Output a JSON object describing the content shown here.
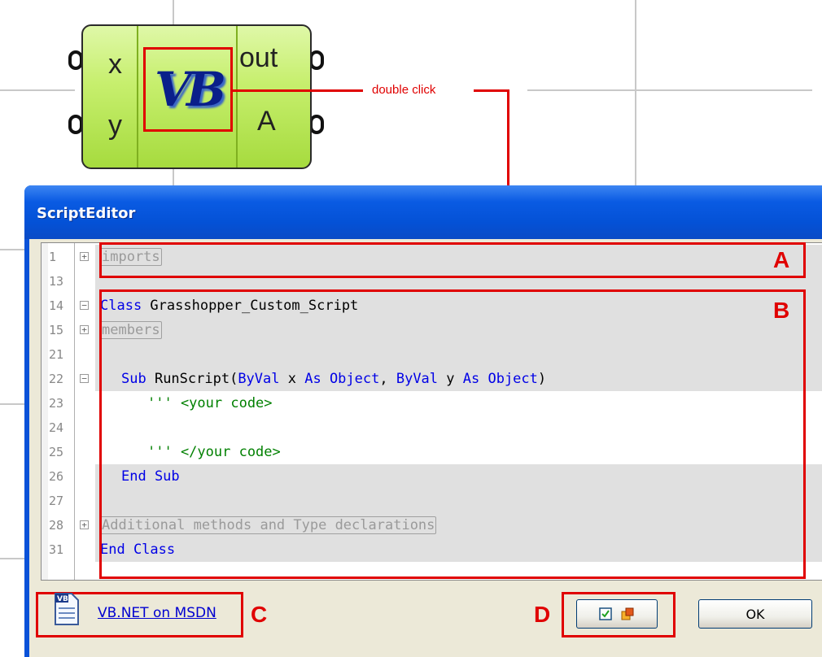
{
  "component": {
    "inputs": [
      "x",
      "y"
    ],
    "outputs": [
      "out",
      "A"
    ],
    "icon_text": "VB",
    "annotation": "double click"
  },
  "window": {
    "title": "ScriptEditor"
  },
  "editor": {
    "lines": [
      {
        "num": "1",
        "fold": "+",
        "text": "imports",
        "style": "collapsed"
      },
      {
        "num": "13",
        "fold": "",
        "text": "",
        "style": "plain"
      },
      {
        "num": "14",
        "fold": "−",
        "kw": "Class",
        "text": " Grasshopper_Custom_Script",
        "style": "class"
      },
      {
        "num": "15",
        "fold": "+",
        "text": "members",
        "style": "collapsed"
      },
      {
        "num": "21",
        "fold": "",
        "text": "",
        "style": "plain"
      },
      {
        "num": "22",
        "fold": "−",
        "text": "Sub RunScript(ByVal x As Object, ByVal y As Object)",
        "style": "sub"
      },
      {
        "num": "23",
        "fold": "",
        "text": "''' <your code>",
        "style": "comment"
      },
      {
        "num": "24",
        "fold": "",
        "text": "",
        "style": "plain"
      },
      {
        "num": "25",
        "fold": "",
        "text": "''' </your code>",
        "style": "comment"
      },
      {
        "num": "26",
        "fold": "",
        "text": "End Sub",
        "style": "endsub"
      },
      {
        "num": "27",
        "fold": "",
        "text": "",
        "style": "plain"
      },
      {
        "num": "28",
        "fold": "+",
        "text": "Additional methods and Type declarations",
        "style": "collapsed"
      },
      {
        "num": "31",
        "fold": "",
        "text": "End Class",
        "style": "endclass"
      }
    ],
    "sub_parts": {
      "sub": "Sub",
      "name": " RunScript(",
      "byval1": "ByVal",
      "x": " x ",
      "as1": "As",
      "obj1": " Object",
      "comma": ", ",
      "byval2": "ByVal",
      "y": " y ",
      "as2": "As",
      "obj2": " Object",
      "close": ")"
    }
  },
  "annotations": {
    "a": "A",
    "b": "B",
    "c": "C",
    "d": "D"
  },
  "footer": {
    "link_text": "VB.NET on MSDN",
    "ok_label": "OK",
    "doc_icon_text": "VB"
  },
  "colors": {
    "annotation_red": "#e00000",
    "keyword_blue": "#0000e6",
    "comment_green": "#008000",
    "titlebar_blue": "#0a5be3"
  }
}
